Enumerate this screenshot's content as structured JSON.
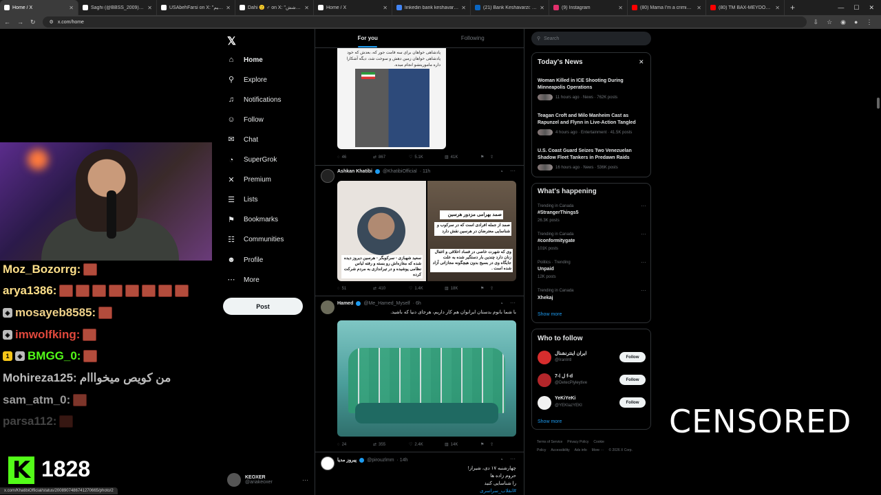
{
  "browser": {
    "tabs": [
      {
        "label": "Home / X",
        "active": true,
        "color": "#ffffff"
      },
      {
        "label": "Saghi (@BBSS_2009) / X",
        "active": false,
        "color": "#ffffff"
      },
      {
        "label": "USAbehFarsi on X: \"انار هستیم",
        "active": false,
        "color": "#ffffff"
      },
      {
        "label": "Dahi 🙂 ♂ on X: \"برای پوشش",
        "active": false,
        "color": "#ffffff"
      },
      {
        "label": "Home / X",
        "active": false,
        "color": "#ffffff"
      },
      {
        "label": "linkedin bank keshavarzi - Goo",
        "active": false,
        "color": "#4285f4"
      },
      {
        "label": "(21) Bank Keshavarzi: Overvie",
        "active": false,
        "color": "#0a66c2"
      },
      {
        "label": "(9) Instagram",
        "active": false,
        "color": "#e1306c"
      },
      {
        "label": "(80) Mama I'm a criminal [OFF",
        "active": false,
        "color": "#ff0000"
      },
      {
        "label": "(80) TM BAX-MEYDOON OFFI",
        "active": false,
        "color": "#ff0000"
      }
    ],
    "new_tab": "+",
    "url": "x.com/home",
    "status_url": "x.com/KhatibiOfficial/status/2008907486741270665/photo/2"
  },
  "stream": {
    "chat": [
      {
        "user": "Moz_Bozorrg:",
        "color": "#ffe08a",
        "emotes": 1,
        "badges": [],
        "text": ""
      },
      {
        "user": "arya1386:",
        "color": "#ffe08a",
        "emotes": 8,
        "badges": [],
        "text": ""
      },
      {
        "user": "mosayeb8585:",
        "color": "#f0d28a",
        "emotes": 1,
        "badges": [
          "◈"
        ],
        "text": ""
      },
      {
        "user": "imwolfking:",
        "color": "#e0483c",
        "emotes": 1,
        "badges": [
          "◈"
        ],
        "text": ""
      },
      {
        "user": "BMGG_0:",
        "color": "#53fc18",
        "emotes": 1,
        "badges": [
          "1",
          "◈"
        ],
        "text": ""
      },
      {
        "user": "Mohireza125:",
        "color": "#bdbdbd",
        "emotes": 0,
        "badges": [],
        "text": "من کویص میخوااام"
      },
      {
        "user": "sam_atm_0:",
        "color": "#9a9a9a",
        "emotes": 1,
        "badges": [],
        "text": ""
      },
      {
        "user": "parsa112:",
        "color": "#444444",
        "emotes": 1,
        "badges": [],
        "text": ""
      }
    ],
    "kick_logo": "K",
    "viewer_count": "1828",
    "censored": "CENSORED",
    "kick_color": "#53fc18"
  },
  "nav": {
    "items": [
      {
        "label": "Home",
        "icon": "home-icon",
        "glyph": "⌂",
        "active": true
      },
      {
        "label": "Explore",
        "icon": "search-icon",
        "glyph": "⚲",
        "active": false
      },
      {
        "label": "Notifications",
        "icon": "bell-icon",
        "glyph": "♫",
        "active": false
      },
      {
        "label": "Follow",
        "icon": "person-plus-icon",
        "glyph": "☺",
        "active": false
      },
      {
        "label": "Chat",
        "icon": "envelope-icon",
        "glyph": "✉",
        "active": false
      },
      {
        "label": "SuperGrok",
        "icon": "grok-icon",
        "glyph": "◔",
        "active": false
      },
      {
        "label": "Premium",
        "icon": "x-premium-icon",
        "glyph": "✕",
        "active": false
      },
      {
        "label": "Lists",
        "icon": "list-icon",
        "glyph": "☰",
        "active": false
      },
      {
        "label": "Bookmarks",
        "icon": "bookmark-icon",
        "glyph": "⚑",
        "active": false
      },
      {
        "label": "Communities",
        "icon": "people-icon",
        "glyph": "☷",
        "active": false
      },
      {
        "label": "Profile",
        "icon": "profile-icon",
        "glyph": "☻",
        "active": false
      },
      {
        "label": "More",
        "icon": "more-circle-icon",
        "glyph": "⋯",
        "active": false
      }
    ],
    "post_label": "Post",
    "account": {
      "name": "KEOXER",
      "handle": "@ariakeoxer"
    }
  },
  "feed": {
    "tabs": [
      "For you",
      "Following"
    ],
    "posts": [
      {
        "overlay_text": "پادشاهی خواهان برای سه قامت جور که، بعدش که خود پادشاهی خواهان زمین دهش و سوخت شد، دیگه آشکارا داره ماموریتشو انجام میده.",
        "replies": "46",
        "reposts": "867",
        "likes": "5.1K",
        "views": "41K"
      },
      {
        "name": "Ashkan Khatibi",
        "handle": "@KhatibiOfficial",
        "time": "· 11h",
        "img_left_caption": "سعید شهبازی - سرکوبگر - هرسین دیروز دیده شده که مغازه‌اش رو بسته و رفته لباس نظامی پوشیده و در تیراندازی به مردم شرکت کرده",
        "img_right_caption_top": "صمد بهرامی مزدور هرسین",
        "img_right_caption_mid": "صمد از جمله افرادی است که در سرکوب و شناسایی معترضان در هرسین نقش دارد",
        "img_right_caption_bottom": "وی که شهرت خاصی در فساد اخلاقی و اغفال زنان دارد چندین بار دستگیر شده به علت جایگاه وی در بسیج بدون هیچگونه مجازاتی آزاد شده است .",
        "replies": "51",
        "reposts": "410",
        "likes": "1.4K",
        "views": "18K"
      },
      {
        "name": "Hamed",
        "handle": "@Me_Hamed_Myself",
        "time": "· 6h",
        "text": "با شما بانوم بدستان ایرانوان هم کار داریم، هرجای دنیا که باشید.",
        "replies": "24",
        "reposts": "355",
        "likes": "2.4K",
        "views": "14K"
      },
      {
        "name": "پیروز مدیا",
        "handle": "@pirouzlmm",
        "time": "· 14h",
        "text_lines": [
          "چهارشنبه ۱۷ دی، شیراز!",
          "حروم زاده ها",
          "را شناسایی کنید",
          "#انقلاب_سراسری"
        ]
      }
    ]
  },
  "sidebar": {
    "search_placeholder": "Search",
    "news": {
      "title": "Today's News",
      "items": [
        {
          "title": "Woman Killed in ICE Shooting During Minneapolis Operations",
          "meta": "11 hours ago · News · 762K posts"
        },
        {
          "title": "Teagan Croft and Milo Manheim Cast as Rapunzel and Flynn in Live-Action Tangled",
          "meta": "4 hours ago · Entertainment · 41.5K posts"
        },
        {
          "title": "U.S. Coast Guard Seizes Two Venezuelan Shadow Fleet Tankers in Predawn Raids",
          "meta": "16 hours ago · News · 536K posts"
        }
      ]
    },
    "happening": {
      "title": "What's happening",
      "items": [
        {
          "context": "Trending in Canada",
          "name": "#StrangerThings5",
          "count": "26.3K posts"
        },
        {
          "context": "Trending in Canada",
          "name": "#conformitygate",
          "count": "101K posts"
        },
        {
          "context": "Politics · Trending",
          "name": "Unpaid",
          "count": "12K posts"
        },
        {
          "context": "Trending in Canada",
          "name": "Xhekaj",
          "count": ""
        }
      ],
      "show_more": "Show more"
    },
    "who_to_follow": {
      "title": "Who to follow",
      "items": [
        {
          "name": "ایران اینترنشنال",
          "handle": "@IranIntl",
          "avatar_color": "#d62d2d",
          "button": "Follow"
        },
        {
          "name": "ﻝ ﺍ-7 f-d",
          "handle": "@DetecPiyleytive",
          "avatar_color": "#b3262a",
          "button": "Follow"
        },
        {
          "name": "YeKiYeKi",
          "handle": "@YEKIazYEKI",
          "avatar_color": "#f2f2f2",
          "button": "Follow"
        }
      ],
      "show_more": "Show more"
    },
    "footer": [
      "Terms of Service",
      "Privacy Policy",
      "Cookie Policy",
      "Accessibility",
      "Ads info",
      "More ···",
      "© 2026 X Corp."
    ]
  }
}
